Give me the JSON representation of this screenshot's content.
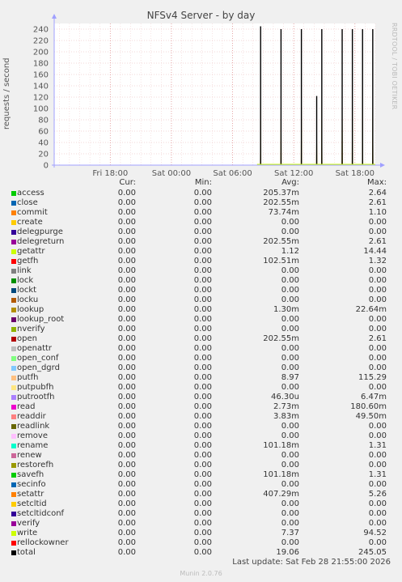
{
  "title": "NFSv4 Server - by day",
  "side_label": "RRDTOOL / TOBI OETIKER",
  "footer": {
    "last_update": "Last update: Sat Feb 28 21:55:00 2026",
    "munin": "Munin 2.0.76"
  },
  "chart_data": {
    "type": "line",
    "ylabel": "requests / second",
    "ylim": [
      0,
      250
    ],
    "yticks": [
      0,
      20,
      40,
      60,
      80,
      100,
      120,
      140,
      160,
      180,
      200,
      220,
      240
    ],
    "x_range_hours": [
      12.5,
      44.0
    ],
    "xticks": [
      {
        "label": "Fri 18:00",
        "hour": 18
      },
      {
        "label": "Sat 00:00",
        "hour": 24
      },
      {
        "label": "Sat 06:00",
        "hour": 30
      },
      {
        "label": "Sat 12:00",
        "hour": 36
      },
      {
        "label": "Sat 18:00",
        "hour": 42
      }
    ],
    "grid": true,
    "spikes": [
      {
        "hour": 32.75,
        "value": 245
      },
      {
        "hour": 34.75,
        "value": 240
      },
      {
        "hour": 36.75,
        "value": 240
      },
      {
        "hour": 38.25,
        "value": 122
      },
      {
        "hour": 38.75,
        "value": 240
      },
      {
        "hour": 40.75,
        "value": 240
      },
      {
        "hour": 41.75,
        "value": 240
      },
      {
        "hour": 42.75,
        "value": 240
      },
      {
        "hour": 43.75,
        "value": 240
      }
    ]
  },
  "legend": {
    "headers": {
      "cur": "Cur:",
      "min": "Min:",
      "avg": "Avg:",
      "max": "Max:"
    },
    "rows": [
      {
        "name": "access",
        "color": "#00cc00",
        "cur": "0.00",
        "min": "0.00",
        "avg": "205.37m",
        "max": "2.64"
      },
      {
        "name": "close",
        "color": "#0066b3",
        "cur": "0.00",
        "min": "0.00",
        "avg": "202.55m",
        "max": "2.61"
      },
      {
        "name": "commit",
        "color": "#ff8000",
        "cur": "0.00",
        "min": "0.00",
        "avg": "73.74m",
        "max": "1.10"
      },
      {
        "name": "create",
        "color": "#ffcc00",
        "cur": "0.00",
        "min": "0.00",
        "avg": "0.00",
        "max": "0.00"
      },
      {
        "name": "delegpurge",
        "color": "#330099",
        "cur": "0.00",
        "min": "0.00",
        "avg": "0.00",
        "max": "0.00"
      },
      {
        "name": "delegreturn",
        "color": "#990099",
        "cur": "0.00",
        "min": "0.00",
        "avg": "202.55m",
        "max": "2.61"
      },
      {
        "name": "getattr",
        "color": "#ccff00",
        "cur": "0.00",
        "min": "0.00",
        "avg": "1.12",
        "max": "14.44"
      },
      {
        "name": "getfh",
        "color": "#ff0000",
        "cur": "0.00",
        "min": "0.00",
        "avg": "102.51m",
        "max": "1.32"
      },
      {
        "name": "link",
        "color": "#808080",
        "cur": "0.00",
        "min": "0.00",
        "avg": "0.00",
        "max": "0.00"
      },
      {
        "name": "lock",
        "color": "#008f00",
        "cur": "0.00",
        "min": "0.00",
        "avg": "0.00",
        "max": "0.00"
      },
      {
        "name": "lockt",
        "color": "#00487d",
        "cur": "0.00",
        "min": "0.00",
        "avg": "0.00",
        "max": "0.00"
      },
      {
        "name": "locku",
        "color": "#b35a00",
        "cur": "0.00",
        "min": "0.00",
        "avg": "0.00",
        "max": "0.00"
      },
      {
        "name": "lookup",
        "color": "#b38f00",
        "cur": "0.00",
        "min": "0.00",
        "avg": "1.30m",
        "max": "22.64m"
      },
      {
        "name": "lookup_root",
        "color": "#6b006b",
        "cur": "0.00",
        "min": "0.00",
        "avg": "0.00",
        "max": "0.00"
      },
      {
        "name": "nverify",
        "color": "#8fb300",
        "cur": "0.00",
        "min": "0.00",
        "avg": "0.00",
        "max": "0.00"
      },
      {
        "name": "open",
        "color": "#b30000",
        "cur": "0.00",
        "min": "0.00",
        "avg": "202.55m",
        "max": "2.61"
      },
      {
        "name": "openattr",
        "color": "#bebebe",
        "cur": "0.00",
        "min": "0.00",
        "avg": "0.00",
        "max": "0.00"
      },
      {
        "name": "open_conf",
        "color": "#80ff80",
        "cur": "0.00",
        "min": "0.00",
        "avg": "0.00",
        "max": "0.00"
      },
      {
        "name": "open_dgrd",
        "color": "#80c9ff",
        "cur": "0.00",
        "min": "0.00",
        "avg": "0.00",
        "max": "0.00"
      },
      {
        "name": "putfh",
        "color": "#ffc080",
        "cur": "0.00",
        "min": "0.00",
        "avg": "8.97",
        "max": "115.29"
      },
      {
        "name": "putpubfh",
        "color": "#ffe680",
        "cur": "0.00",
        "min": "0.00",
        "avg": "0.00",
        "max": "0.00"
      },
      {
        "name": "putrootfh",
        "color": "#aa80ff",
        "cur": "0.00",
        "min": "0.00",
        "avg": "46.30u",
        "max": "6.47m"
      },
      {
        "name": "read",
        "color": "#ee00cc",
        "cur": "0.00",
        "min": "0.00",
        "avg": "2.73m",
        "max": "180.60m"
      },
      {
        "name": "readdir",
        "color": "#ff8080",
        "cur": "0.00",
        "min": "0.00",
        "avg": "3.83m",
        "max": "49.50m"
      },
      {
        "name": "readlink",
        "color": "#666600",
        "cur": "0.00",
        "min": "0.00",
        "avg": "0.00",
        "max": "0.00"
      },
      {
        "name": "remove",
        "color": "#ffbfff",
        "cur": "0.00",
        "min": "0.00",
        "avg": "0.00",
        "max": "0.00"
      },
      {
        "name": "rename",
        "color": "#00ffcc",
        "cur": "0.00",
        "min": "0.00",
        "avg": "101.18m",
        "max": "1.31"
      },
      {
        "name": "renew",
        "color": "#cc6699",
        "cur": "0.00",
        "min": "0.00",
        "avg": "0.00",
        "max": "0.00"
      },
      {
        "name": "restorefh",
        "color": "#999900",
        "cur": "0.00",
        "min": "0.00",
        "avg": "0.00",
        "max": "0.00"
      },
      {
        "name": "savefh",
        "color": "#00cc00",
        "cur": "0.00",
        "min": "0.00",
        "avg": "101.18m",
        "max": "1.31"
      },
      {
        "name": "secinfo",
        "color": "#0066b3",
        "cur": "0.00",
        "min": "0.00",
        "avg": "0.00",
        "max": "0.00"
      },
      {
        "name": "setattr",
        "color": "#ff8000",
        "cur": "0.00",
        "min": "0.00",
        "avg": "407.29m",
        "max": "5.26"
      },
      {
        "name": "setcltid",
        "color": "#ffcc00",
        "cur": "0.00",
        "min": "0.00",
        "avg": "0.00",
        "max": "0.00"
      },
      {
        "name": "setcltidconf",
        "color": "#330099",
        "cur": "0.00",
        "min": "0.00",
        "avg": "0.00",
        "max": "0.00"
      },
      {
        "name": "verify",
        "color": "#990099",
        "cur": "0.00",
        "min": "0.00",
        "avg": "0.00",
        "max": "0.00"
      },
      {
        "name": "write",
        "color": "#ccff00",
        "cur": "0.00",
        "min": "0.00",
        "avg": "7.37",
        "max": "94.52"
      },
      {
        "name": "rellockowner",
        "color": "#ff0000",
        "cur": "0.00",
        "min": "0.00",
        "avg": "0.00",
        "max": "0.00"
      },
      {
        "name": "total",
        "color": "#000000",
        "cur": "0.00",
        "min": "0.00",
        "avg": "19.06",
        "max": "245.05"
      }
    ]
  }
}
